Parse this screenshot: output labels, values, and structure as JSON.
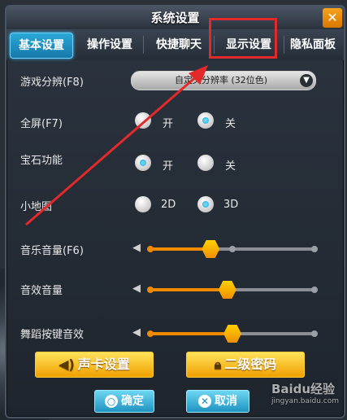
{
  "window": {
    "title": "系统设置",
    "close_glyph": "✕"
  },
  "tabs": [
    "基本设置",
    "操作设置",
    "快捷聊天",
    "显示设置",
    "隐私面板"
  ],
  "settings": {
    "resolution_label": "游戏分辨(F8)",
    "resolution_value": "自定义分辨率 (32位色)",
    "fullscreen_label": "全屏(F7)",
    "fullscreen_on": "开",
    "fullscreen_off": "关",
    "fullscreen_selected": "off",
    "gem_label": "宝石功能",
    "gem_on": "开",
    "gem_off": "关",
    "gem_selected": "on",
    "minimap_label": "小地图",
    "minimap_2d": "2D",
    "minimap_3d": "3D",
    "minimap_selected": "3D"
  },
  "volume": {
    "music_label": "音乐音量(F6)",
    "music_level": 0.37,
    "effects_label": "音效音量",
    "effects_level": 0.47,
    "dance_label": "舞蹈按键音效",
    "dance_level": 0.5
  },
  "buttons": {
    "sound_card": "声卡设置",
    "secondary_password": "二级密码",
    "ok": "确定",
    "cancel": "取消"
  },
  "watermark": {
    "brand": "Baidu经验",
    "url": "jingyan.baidu.com"
  },
  "colors": {
    "accent_orange": "#f08a00",
    "tab_active": "#1e8fc4",
    "annotation_red": "#e32a2a"
  },
  "annotation": {
    "target": "显示设置"
  }
}
